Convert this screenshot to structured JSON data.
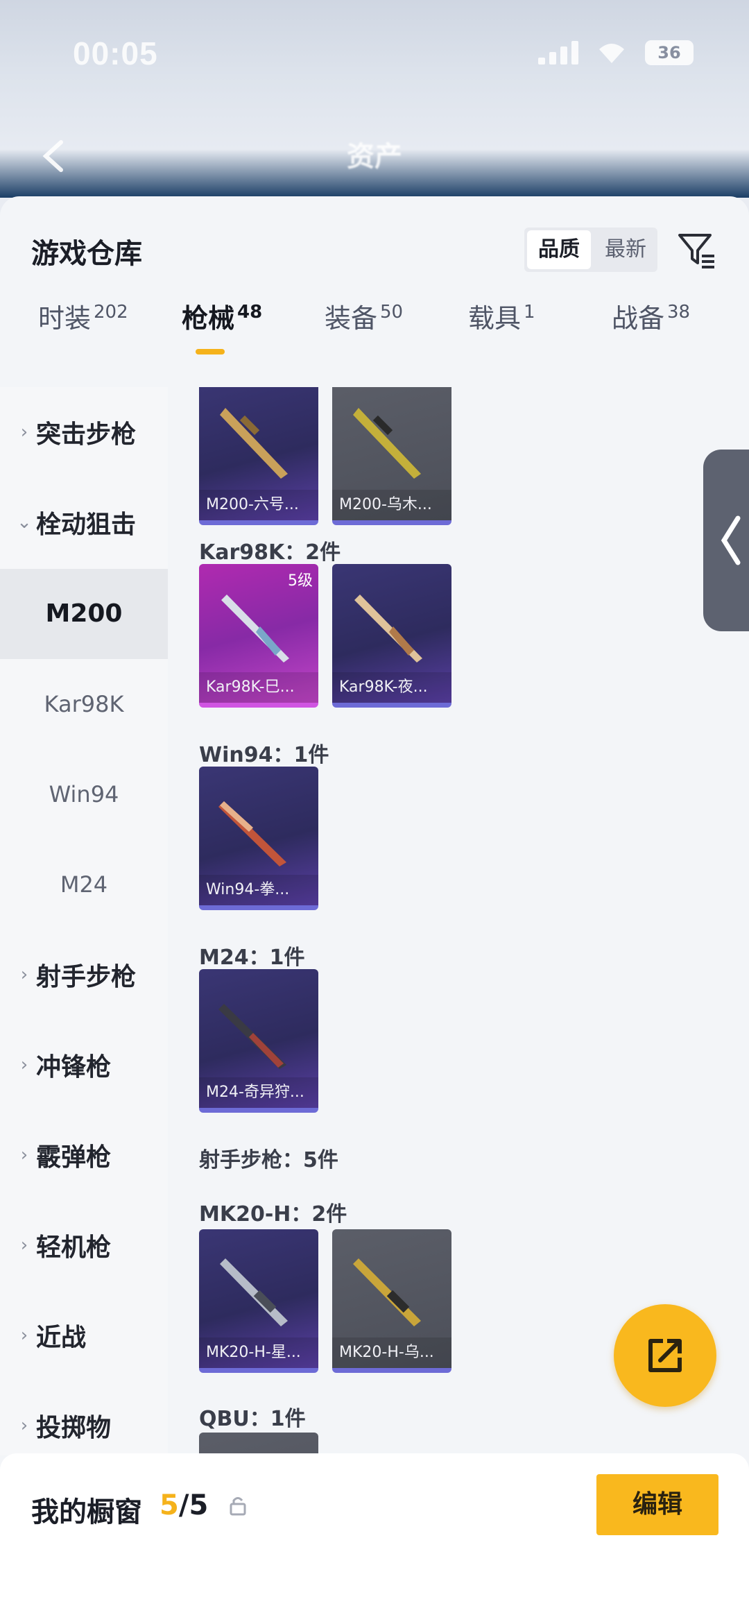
{
  "status_bar": {
    "time": "00:05",
    "battery": "36"
  },
  "header": {
    "title": "资产"
  },
  "sheet": {
    "title": "游戏仓库",
    "sort": {
      "options": [
        "品质",
        "最新"
      ],
      "selected": "品质"
    }
  },
  "tabs": [
    {
      "label": "时装",
      "count": "202"
    },
    {
      "label": "枪械",
      "count": "48",
      "active": true
    },
    {
      "label": "装备",
      "count": "50"
    },
    {
      "label": "载具",
      "count": "1"
    },
    {
      "label": "战备",
      "count": "38"
    }
  ],
  "categories": {
    "assault_rifle": "突击步枪",
    "bolt_sniper": "栓动狙击",
    "sub": [
      "M200",
      "Kar98K",
      "Win94",
      "M24"
    ],
    "marksman": "射手步枪",
    "smg": "冲锋枪",
    "shotgun": "霰弹枪",
    "lmg": "轻机枪",
    "melee": "近战",
    "throwable": "投掷物"
  },
  "content": {
    "m200_cards": [
      "M200-六号...",
      "M200-乌木..."
    ],
    "kar98k_title": "Kar98K：2件",
    "kar98k_cards": [
      "Kar98K-巳...",
      "Kar98K-夜..."
    ],
    "kar98k_badge": "5级",
    "win94_title": "Win94：1件",
    "win94_cards": [
      "Win94-拳..."
    ],
    "m24_title": "M24：1件",
    "m24_cards": [
      "M24-奇异狩..."
    ],
    "marksman_title": "射手步枪：5件",
    "mk20_title": "MK20-H：2件",
    "mk20_cards": [
      "MK20-H-星...",
      "MK20-H-乌..."
    ],
    "qbu_title": "QBU：1件"
  },
  "bottom_bar": {
    "label": "我的橱窗",
    "current": "5",
    "total": "/5",
    "edit": "编辑"
  },
  "colors": {
    "accent": "#f9b81e",
    "card_purple": "#2e2b5e",
    "card_grey": "#4c4f59",
    "card_pink": "#b02ab0"
  },
  "icons": [
    "back-icon",
    "filter-icon",
    "chevron-right-icon",
    "chevron-down-icon",
    "drawer-arrow-icon",
    "share-icon",
    "lock-icon"
  ]
}
